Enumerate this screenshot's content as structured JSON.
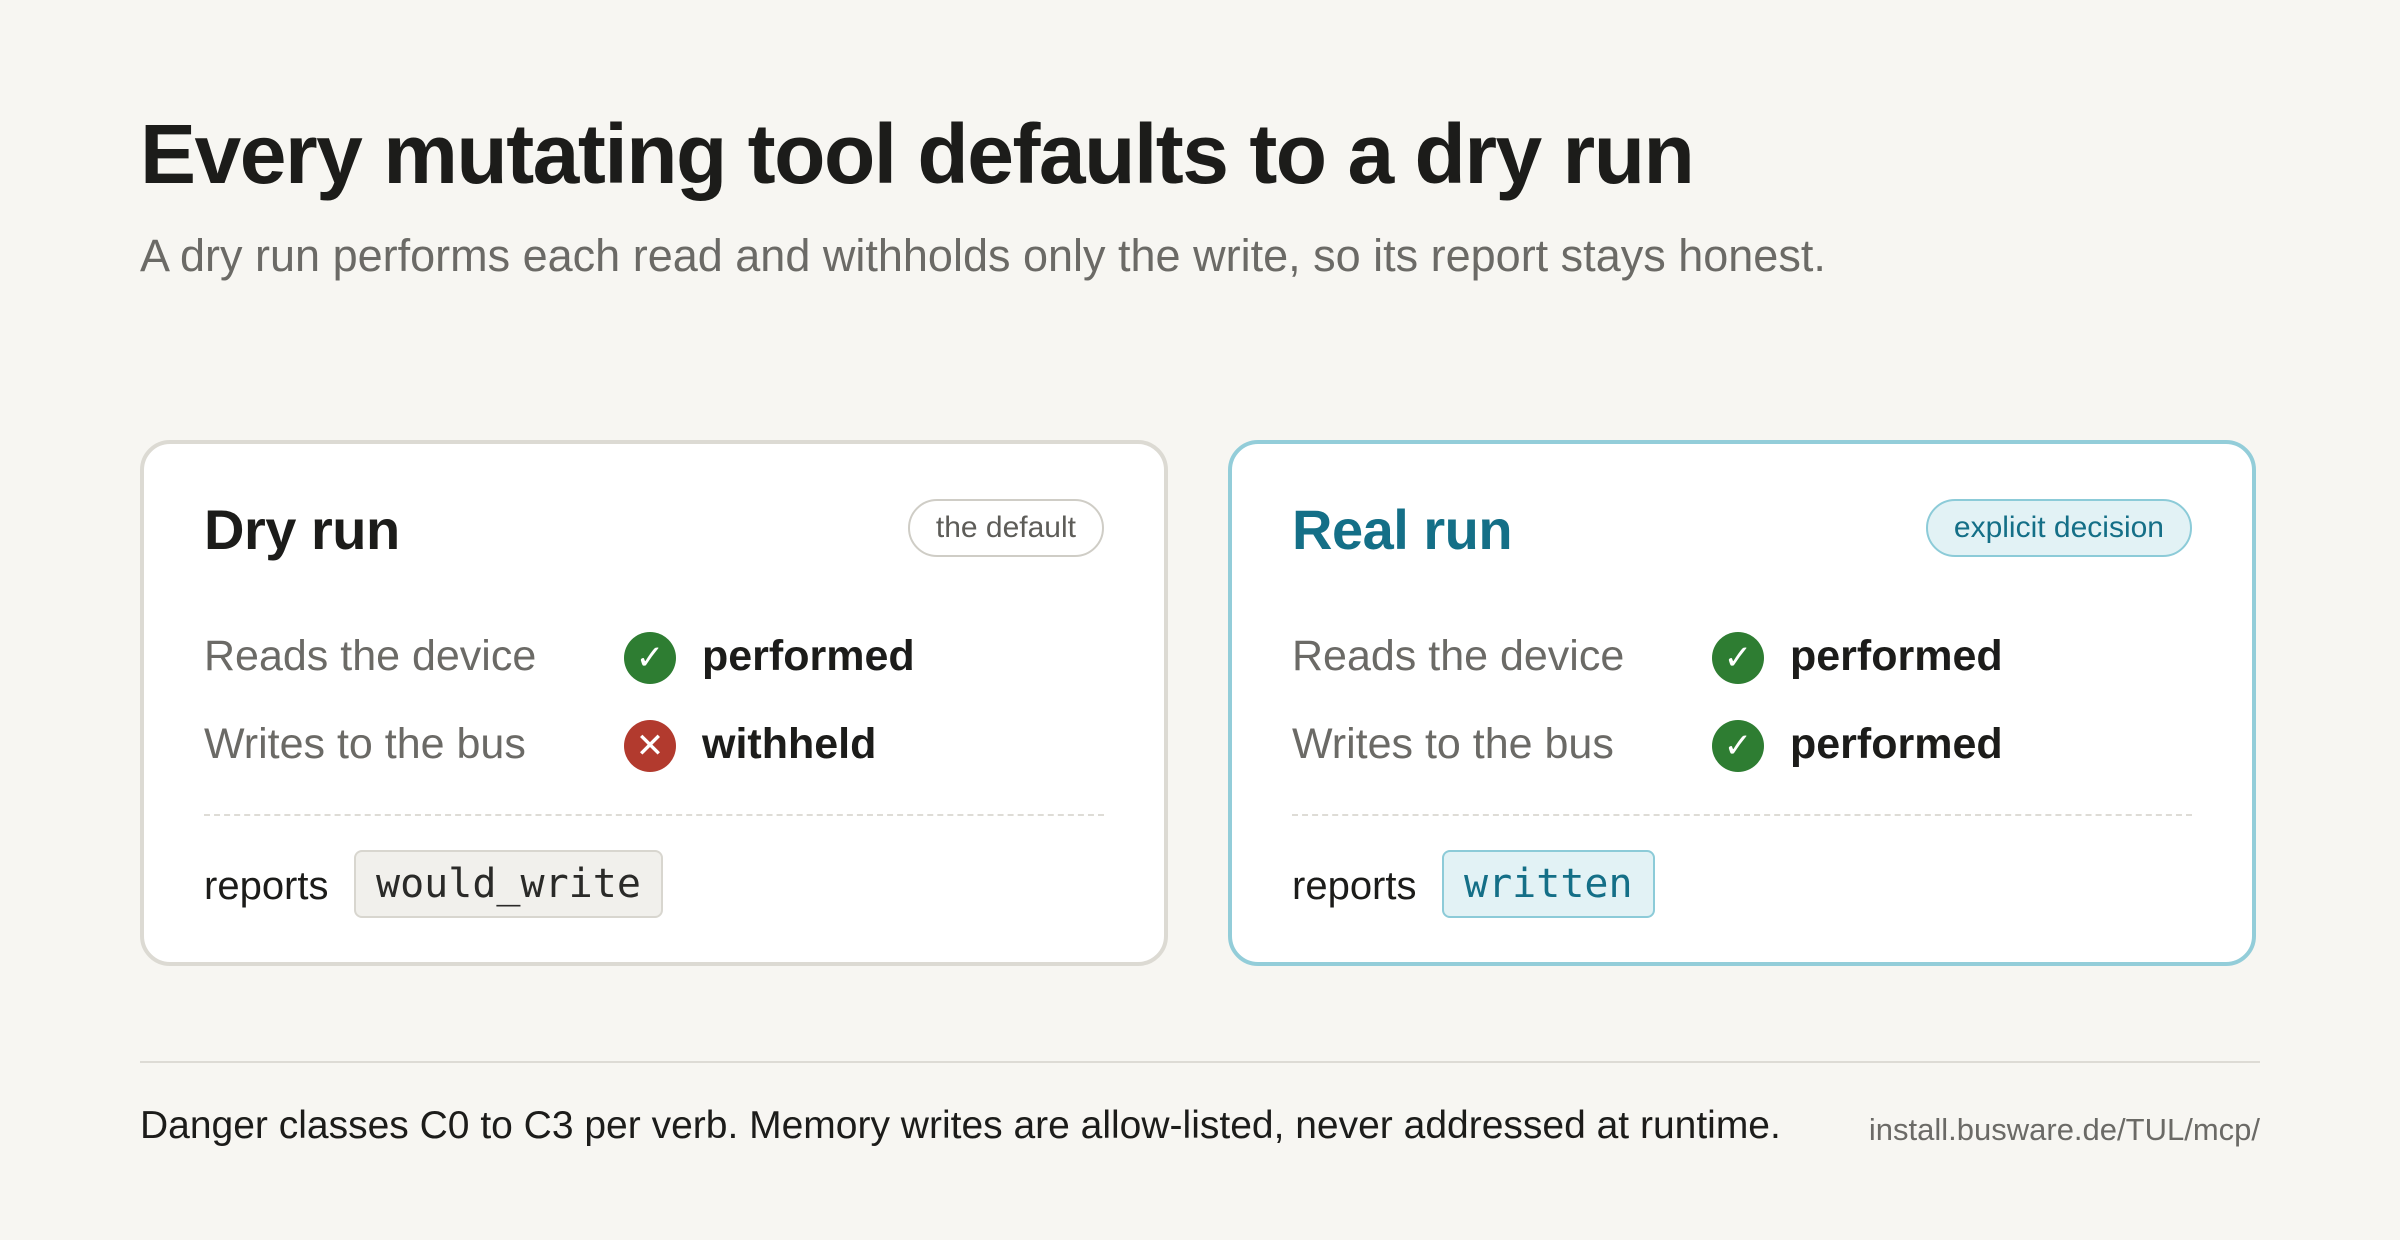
{
  "header": {
    "title": "Every mutating tool defaults to a dry run",
    "subtitle": "A dry run performs each read and withholds only the write, so its report stays honest."
  },
  "cards": {
    "dry": {
      "title": "Dry run",
      "badge": "the default",
      "rows": [
        {
          "label": "Reads the device",
          "status": "performed",
          "icon": "check-icon"
        },
        {
          "label": "Writes to the bus",
          "status": "withheld",
          "icon": "cross-icon"
        }
      ],
      "report_label": "reports",
      "report_value": "would_write"
    },
    "real": {
      "title": "Real run",
      "badge": "explicit decision",
      "rows": [
        {
          "label": "Reads the device",
          "status": "performed",
          "icon": "check-icon"
        },
        {
          "label": "Writes to the bus",
          "status": "performed",
          "icon": "check-icon"
        }
      ],
      "report_label": "reports",
      "report_value": "written"
    }
  },
  "footer": {
    "note": "Danger classes C0 to C3 per verb. Memory writes are allow-listed, never addressed at runtime.",
    "url": "install.busware.de/TUL/mcp/"
  },
  "colors": {
    "background": "#f7f6f2",
    "accent": "#146f87",
    "success": "#2e7d32",
    "danger": "#b23a2e"
  }
}
